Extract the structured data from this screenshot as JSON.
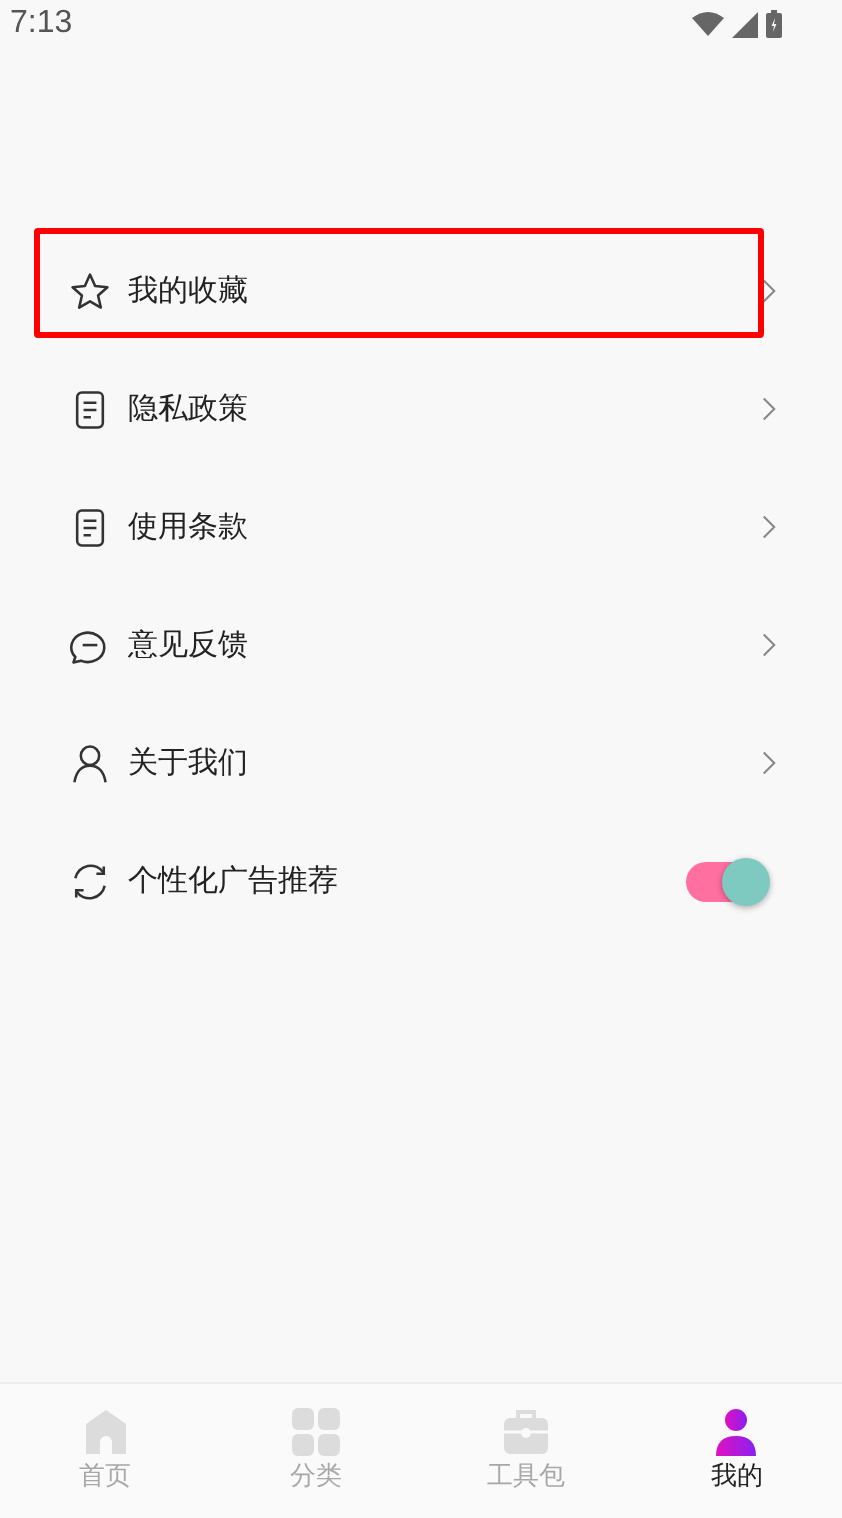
{
  "status_bar": {
    "time": "7:13"
  },
  "menu": [
    {
      "kind": "link",
      "label": "我的收藏",
      "highlighted": true
    },
    {
      "kind": "link",
      "label": "隐私政策",
      "highlighted": false
    },
    {
      "kind": "link",
      "label": "使用条款",
      "highlighted": false
    },
    {
      "kind": "link",
      "label": "意见反馈",
      "highlighted": false
    },
    {
      "kind": "link",
      "label": "关于我们",
      "highlighted": false
    },
    {
      "kind": "toggle",
      "label": "个性化广告推荐",
      "highlighted": false,
      "on": true
    }
  ],
  "tab_bar": [
    {
      "label": "首页",
      "selected": false
    },
    {
      "label": "分类",
      "selected": false
    },
    {
      "label": "工具包",
      "selected": false
    },
    {
      "label": "我的",
      "selected": true
    }
  ]
}
